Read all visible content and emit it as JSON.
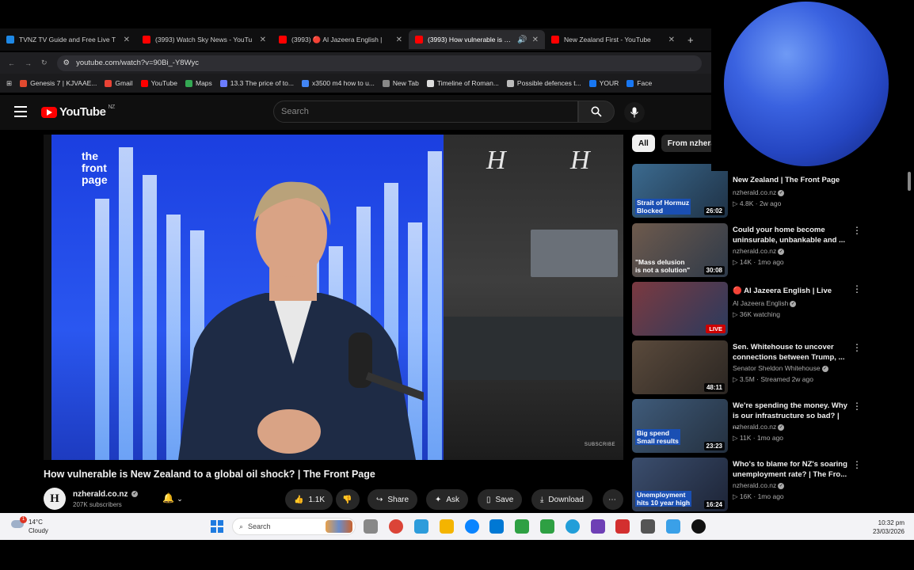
{
  "browser": {
    "tabs": [
      {
        "title": "TVNZ TV Guide and Free Live T",
        "color": "#1e88e5"
      },
      {
        "title": "(3993) Watch Sky News - YouTu",
        "color": "#ff0000"
      },
      {
        "title": "(3993) 🔴 Al Jazeera English |",
        "color": "#ff0000"
      },
      {
        "title": "(3993) How vulnerable is Ne",
        "color": "#ff0000"
      },
      {
        "title": "New Zealand First - YouTube",
        "color": "#ff0000"
      }
    ],
    "new_tab_symbol": "+",
    "url": "youtube.com/watch?v=90Bi_-Y8Wyc",
    "bookmarks": [
      {
        "label": "Genesis 7 | KJVAAE...",
        "color": "#e24a2f"
      },
      {
        "label": "Gmail",
        "color": "#ea4335"
      },
      {
        "label": "YouTube",
        "color": "#ff0000"
      },
      {
        "label": "Maps",
        "color": "#34a853"
      },
      {
        "label": "13.3 The price of to...",
        "color": "#6b7cff"
      },
      {
        "label": "x3500 m4 how to u...",
        "color": "#4285f4"
      },
      {
        "label": "New Tab",
        "color": "#888888"
      },
      {
        "label": "Timeline of Roman...",
        "color": "#dddddd"
      },
      {
        "label": "Possible defences t...",
        "color": "#bbbbbb"
      },
      {
        "label": "YOUR",
        "color": "#1877f2"
      },
      {
        "label": "Face",
        "color": "#1877f2"
      }
    ]
  },
  "youtube": {
    "logo_text": "YouTube",
    "logo_region": "NZ",
    "search_placeholder": "Search",
    "video": {
      "overlay_brand": "the front page",
      "watermark": "H",
      "subscribe_mark": "SUBSCRIBE",
      "title": "How vulnerable is New Zealand to a global oil shock? | The Front Page",
      "channel": "nzherald.co.nz",
      "channel_initial": "H",
      "subscribers": "207K subscribers",
      "likes": "1.1K",
      "share": "Share",
      "ask": "Ask",
      "save": "Save",
      "download": "Download"
    },
    "chips": [
      "All",
      "From nzhera"
    ],
    "related": [
      {
        "title_line1": "New Zealand | The Front Page",
        "title_line2": "",
        "channel": "nzherald.co.nz",
        "meta": "4.8K · 2w ago",
        "duration": "26:02",
        "overlay": "Strait of Hormuz\nBlocked",
        "thumb": "#3b6a8f"
      },
      {
        "title_line1": "Could your home become",
        "title_line2": "uninsurable, unbankable and ...",
        "channel": "nzherald.co.nz",
        "meta": "14K · 1mo ago",
        "duration": "30:08",
        "overlay": "\"Mass delusion\nis not a solution\"",
        "thumb": "#6e5a4c"
      },
      {
        "title_line1": "🔴 Al Jazeera English | Live",
        "title_line2": "",
        "channel": "Al Jazeera English",
        "meta": "36K watching",
        "duration": "LIVE",
        "overlay": "",
        "thumb": "#7b3940"
      },
      {
        "title_line1": "Sen. Whitehouse to uncover",
        "title_line2": "connections between Trump, ...",
        "channel": "Senator Sheldon Whitehouse",
        "meta": "3.5M · Streamed 2w ago",
        "duration": "48:11",
        "overlay": "",
        "thumb": "#5a4a3c"
      },
      {
        "title_line1": "We're spending the money. Why",
        "title_line2": "is our infrastructure so bad? | ...",
        "channel": "nzherald.co.nz",
        "meta": "11K · 1mo ago",
        "duration": "23:23",
        "overlay": "Big spend\nSmall results",
        "thumb": "#3f5b7a"
      },
      {
        "title_line1": "Who's to blame for NZ's soaring",
        "title_line2": "unemployment rate? | The Fro...",
        "channel": "nzherald.co.nz",
        "meta": "16K · 1mo ago",
        "duration": "16:24",
        "overlay": "Unemployment\nhits 10 year high",
        "thumb": "#3b4e6e"
      }
    ]
  },
  "taskbar": {
    "temperature": "14°C",
    "condition": "Cloudy",
    "notification_count": "1",
    "search_placeholder": "Search",
    "time": "10:32 pm",
    "date": "23/03/2026",
    "app_colors": [
      "#888888",
      "#db4437",
      "#2d9cdb",
      "#f4b400",
      "#0a84ff",
      "#0078d4",
      "#2ea043",
      "#229ed9",
      "#6e3fb5",
      "#d32f2f",
      "#555555",
      "#3aa0e8",
      "#111111"
    ]
  }
}
